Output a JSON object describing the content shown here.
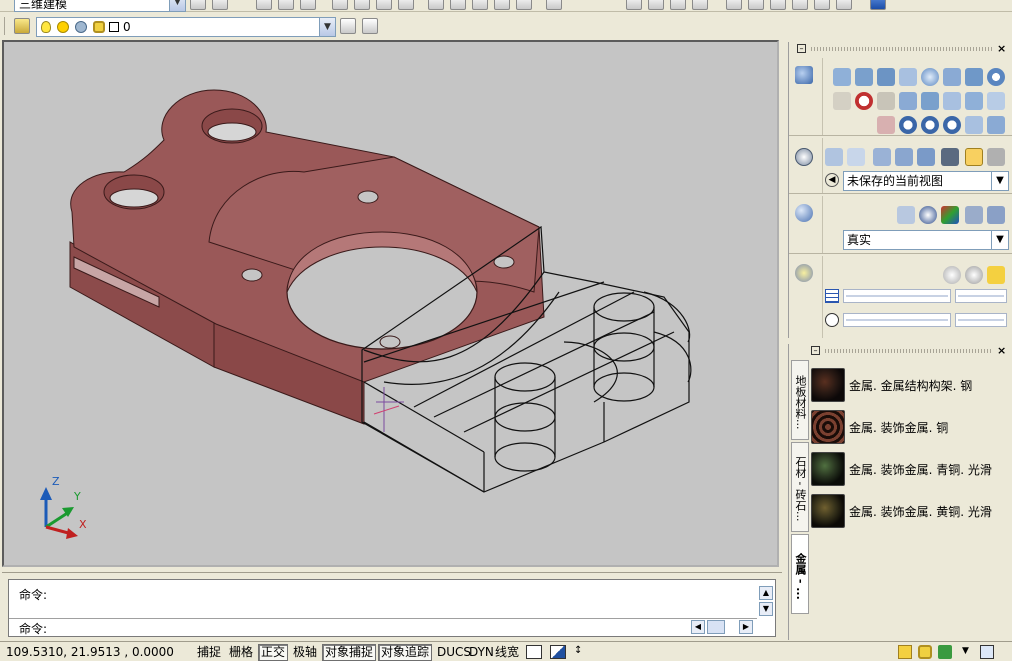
{
  "toolbar": {
    "workspace_combo": "三维建模",
    "layer_combo_value": "0"
  },
  "colors": {
    "part_fill": "#9a5858",
    "viewport_bg": "#c5c5c5",
    "accent_blue": "#1c5bb8"
  },
  "palette": {
    "view_select": "未保存的当前视图",
    "visual_style_select": "真实"
  },
  "materials": {
    "tabs": [
      "地板材料...",
      "石材 - 砖石...",
      "金属 - ..."
    ],
    "items": [
      {
        "label": "金属. 金属结构构架. 钢"
      },
      {
        "label": "金属. 装饰金属. 铜"
      },
      {
        "label": "金属. 装饰金属. 青铜. 光滑"
      },
      {
        "label": "金属. 装饰金属. 黄铜. 光滑"
      }
    ]
  },
  "command": {
    "line1": "命令:",
    "line2": "命令:"
  },
  "status": {
    "coordinates": "109.5310, 21.9513 , 0.0000",
    "buttons": [
      "捕捉",
      "栅格",
      "正交",
      "极轴",
      "对象捕捉",
      "对象追踪",
      "DUCS",
      "DYN",
      "线宽"
    ]
  },
  "ucs": {
    "x": "X",
    "y": "Y",
    "z": "Z"
  }
}
